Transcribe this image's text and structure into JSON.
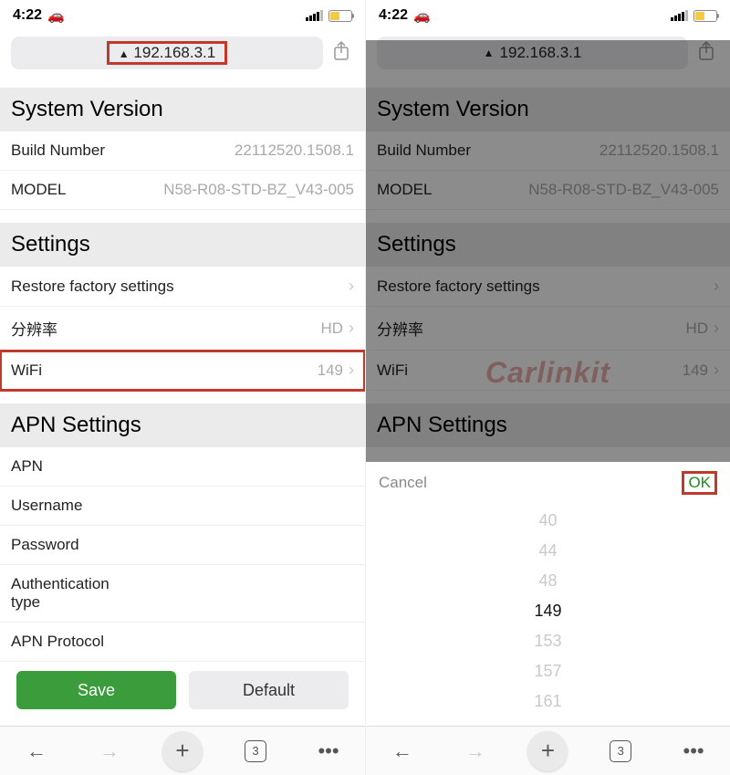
{
  "status": {
    "time": "4:22"
  },
  "address": {
    "url": "192.168.3.1"
  },
  "system_version": {
    "header": "System Version",
    "build_label": "Build Number",
    "build_value": "22112520.1508.1",
    "model_label": "MODEL",
    "model_value": "N58-R08-STD-BZ_V43-005"
  },
  "settings": {
    "header": "Settings",
    "restore_label": "Restore factory settings",
    "resolution_label": "分辨率",
    "resolution_value": "HD",
    "wifi_label": "WiFi",
    "wifi_value": "149"
  },
  "apn": {
    "header": "APN Settings",
    "apn_label": "APN",
    "user_label": "Username",
    "pass_label": "Password",
    "auth_label": "Authentication type",
    "proto_label": "APN Protocol"
  },
  "buttons": {
    "save": "Save",
    "default": "Default"
  },
  "browser": {
    "tab_count": "3"
  },
  "picker": {
    "cancel": "Cancel",
    "ok": "OK",
    "options": [
      "40",
      "44",
      "48",
      "149",
      "153",
      "157",
      "161"
    ],
    "selected": "149"
  },
  "watermark": "Carlinkit"
}
